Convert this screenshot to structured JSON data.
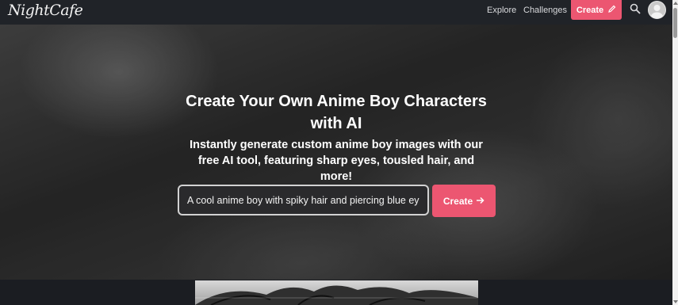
{
  "nav": {
    "logo": "NightCafe",
    "explore": "Explore",
    "challenges": "Challenges",
    "create": "Create",
    "icons": {
      "create": "pencil-icon",
      "search": "search-icon",
      "avatar": "user-avatar-icon"
    }
  },
  "hero": {
    "title": "Create Your Own Anime Boy Characters with AI",
    "subtitle": "Instantly generate custom anime boy images with our free AI tool, featuring sharp eyes, tousled hair, and more!",
    "prompt_value": "A cool anime boy with spiky hair and piercing blue eyes",
    "create_label": "Create",
    "create_icon": "arrow-right-icon"
  },
  "colors": {
    "accent": "#ec5671",
    "navbar": "#202328",
    "page_bg": "#1b1d22"
  }
}
